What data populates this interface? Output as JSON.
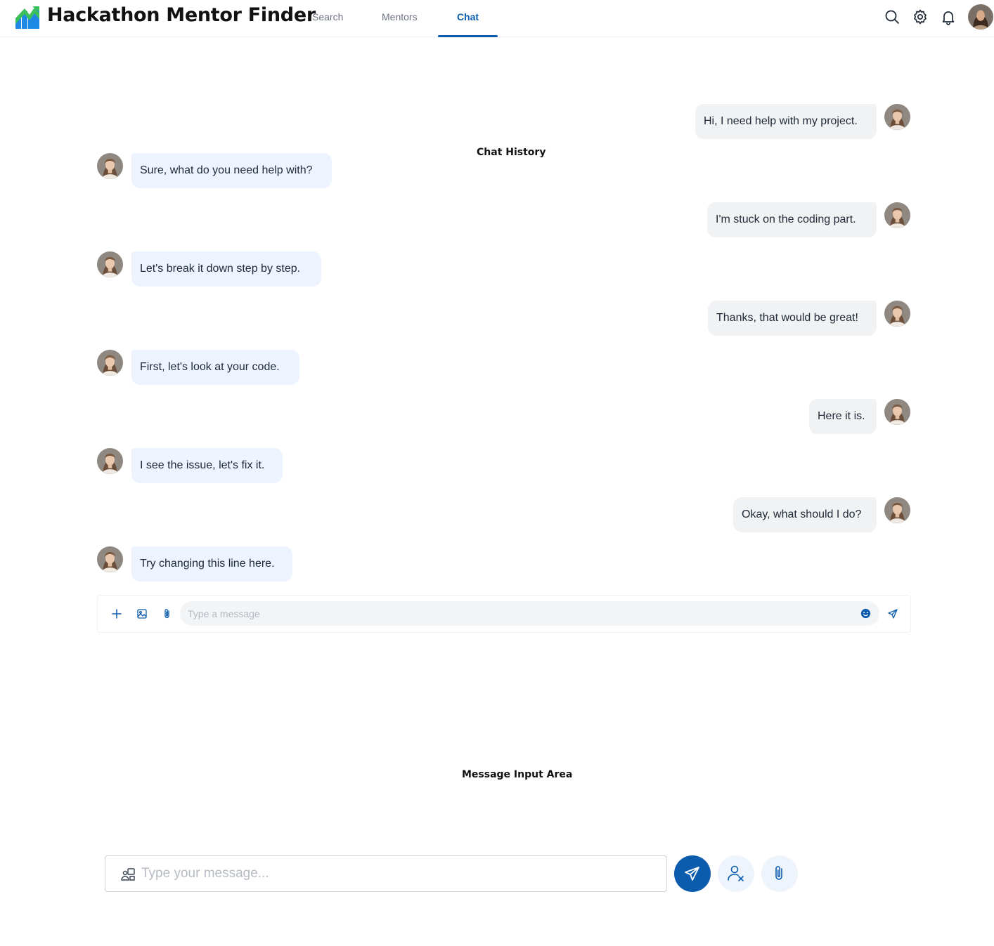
{
  "app": {
    "title": "Hackathon Mentor Finder"
  },
  "nav": {
    "search": "Search",
    "mentors": "Mentors",
    "chat": "Chat",
    "active": "Chat"
  },
  "header_icons": [
    "search-icon",
    "settings-gear-icon",
    "notification-bell-icon",
    "user-avatar"
  ],
  "sections": {
    "chat_history": "Chat History",
    "message_input_area": "Message Input Area"
  },
  "messages": [
    {
      "from": "user",
      "text": "Hi, I need help with my project."
    },
    {
      "from": "mentor",
      "text": "Sure, what do you need help with?"
    },
    {
      "from": "user",
      "text": "I'm stuck on the coding part."
    },
    {
      "from": "mentor",
      "text": "Let's break it down step by step."
    },
    {
      "from": "user",
      "text": "Thanks, that would be great!"
    },
    {
      "from": "mentor",
      "text": "First, let's look at your code."
    },
    {
      "from": "user",
      "text": "Here it is."
    },
    {
      "from": "mentor",
      "text": "I see the issue, let's fix it."
    },
    {
      "from": "user",
      "text": "Okay, what should I do?"
    },
    {
      "from": "mentor",
      "text": "Try changing this line here."
    }
  ],
  "compact_input": {
    "placeholder": "Type a message",
    "icons": [
      "plus-icon",
      "image-icon",
      "paperclip-icon",
      "emoji-icon",
      "send-icon"
    ]
  },
  "main_input": {
    "placeholder": "Type your message...",
    "icons": [
      "users-icon",
      "send-icon",
      "remove-user-icon",
      "paperclip-icon"
    ]
  },
  "colors": {
    "accent": "#0b5cad",
    "outgoing_bubble": "#f1f2f4",
    "incoming_bubble": "#eef4ff"
  }
}
